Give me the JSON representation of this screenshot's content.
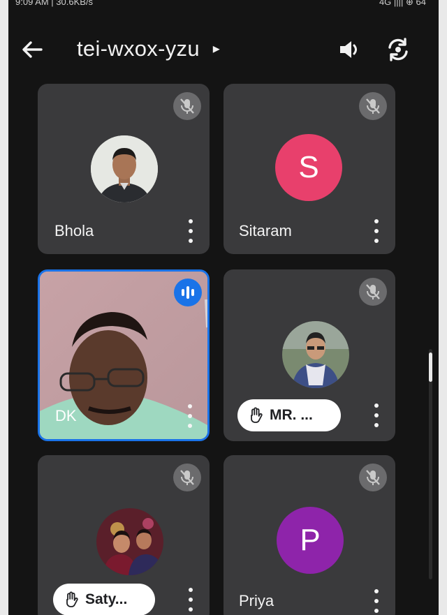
{
  "status_bar": {
    "time_speed": "9:09 AM | 30.6KB/s",
    "right": "4G  ||||  ⊕  64"
  },
  "header": {
    "meeting_code": "tei-wxox-yzu",
    "title_arrow": "▸",
    "back_icon": "arrow-left-icon",
    "audio_icon": "speaker-icon",
    "switch_camera_icon": "switch-camera-icon"
  },
  "participants": [
    {
      "name": "Bhola",
      "avatar": "photo",
      "muted": true,
      "hand_raised": false
    },
    {
      "name": "Sitaram",
      "avatar_letter": "S",
      "avatar_color": "#e8406c",
      "muted": true,
      "hand_raised": false
    },
    {
      "name": "DK",
      "avatar": "video",
      "speaking": true,
      "hand_raised": false
    },
    {
      "name": "MR. ...",
      "avatar": "photo",
      "muted": true,
      "hand_raised": true
    },
    {
      "name": "Saty...",
      "avatar": "photo",
      "muted": true,
      "hand_raised": true
    },
    {
      "name": "Priya",
      "avatar_letter": "P",
      "avatar_color": "#8e24aa",
      "muted": true,
      "hand_raised": false
    }
  ],
  "colors": {
    "background": "#141414",
    "tile": "#3a3a3c",
    "accent": "#1a73e8"
  }
}
